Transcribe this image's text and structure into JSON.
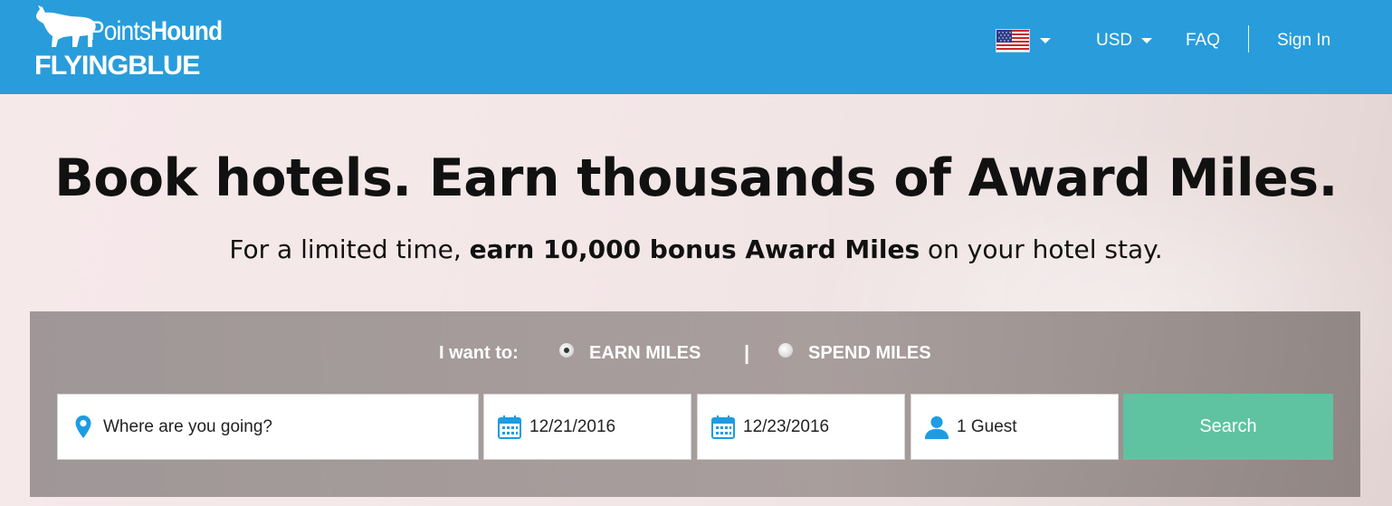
{
  "header": {
    "logo_top_light": "Points",
    "logo_top_bold": "Hound",
    "logo_bottom": "FLYINGBLUE",
    "locale_icon": "us-flag-icon",
    "currency": "USD",
    "faq": "FAQ",
    "sign_in": "Sign In",
    "brand_color": "#299ddb"
  },
  "hero": {
    "headline": "Book hotels. Earn thousands of Award Miles.",
    "subline_pre": "For a limited time, ",
    "subline_bold": "earn 10,000 bonus Award Miles",
    "subline_post": " on your hotel stay."
  },
  "search": {
    "mode_prompt": "I want to:",
    "earn_label": "EARN MILES",
    "separator": "|",
    "spend_label": "SPEND MILES",
    "selected_mode": "earn",
    "destination_placeholder": "Where are you going?",
    "check_in": "12/21/2016",
    "check_out": "12/23/2016",
    "guests": "1 Guest",
    "button": "Search",
    "button_color": "#5fc2a1",
    "icon_color": "#1b9ce3"
  }
}
